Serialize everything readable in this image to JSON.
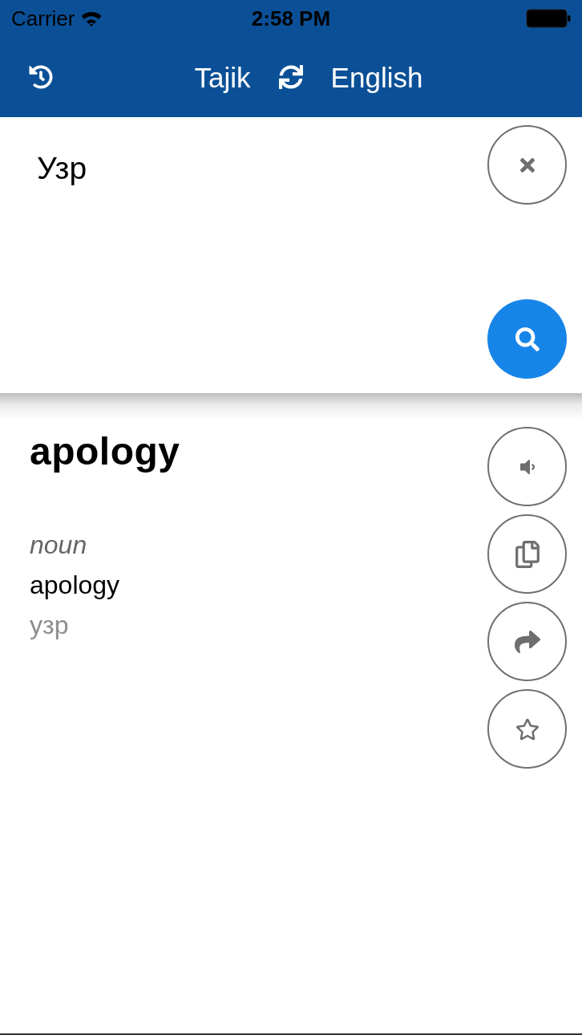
{
  "status_bar": {
    "carrier": "Carrier",
    "time": "2:58 PM"
  },
  "nav_bar": {
    "source_language": "Tajik",
    "target_language": "English"
  },
  "input": {
    "value": "Узр"
  },
  "result": {
    "headword": "apology",
    "entries": [
      {
        "part_of_speech": "noun",
        "translation": "apology",
        "source": "узр"
      }
    ]
  },
  "actions": [
    {
      "kind": "speak"
    },
    {
      "kind": "copy"
    },
    {
      "kind": "share"
    },
    {
      "kind": "favorite",
      "selected": false
    }
  ]
}
